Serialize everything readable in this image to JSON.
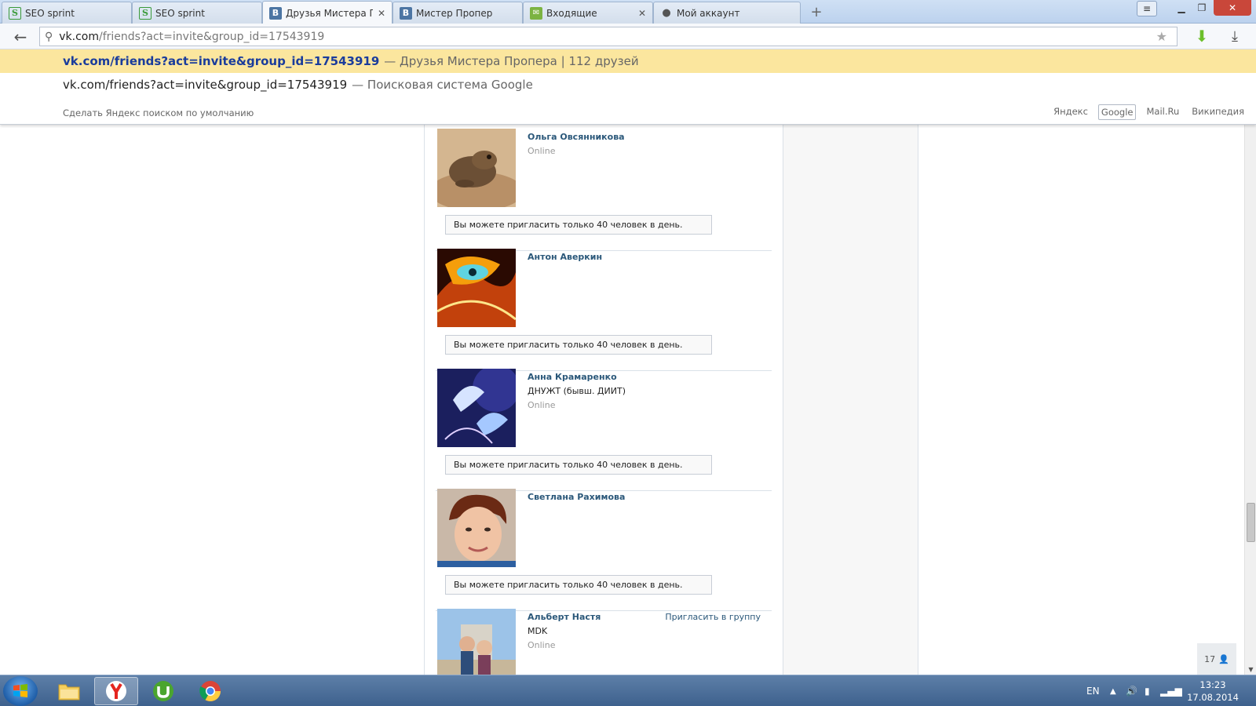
{
  "tabs": [
    {
      "label": "SEO sprint",
      "icon": "seo-sprint-icon",
      "active": false
    },
    {
      "label": "SEO sprint",
      "icon": "seo-sprint-icon",
      "active": false
    },
    {
      "label": "Друзья Мистера Про",
      "icon": "vk-icon",
      "active": true
    },
    {
      "label": "Мистер Пропер",
      "icon": "vk-icon",
      "active": false
    },
    {
      "label": "Входящие",
      "icon": "mail-icon",
      "active": false
    },
    {
      "label": "Мой аккаунт",
      "icon": "account-icon",
      "active": false
    }
  ],
  "address": {
    "host": "vk.com",
    "path": "/friends?act=invite&group_id=17543919"
  },
  "suggestions": [
    {
      "url": "vk.com/friends?act=invite&group_id=17543919",
      "desc": "— Друзья Мистера Пропера | 112 друзей"
    },
    {
      "url": "vk.com/friends?act=invite&group_id=17543919",
      "desc": "— Поисковая система Google"
    }
  ],
  "suggestion_footer": "Сделать Яндекс поиском по умолчанию",
  "search_engines": [
    "Яндекс",
    "Google",
    "Mail.Ru",
    "Википедия"
  ],
  "selected_engine": "Google",
  "friends": [
    {
      "name": "Ольга Овсянникова",
      "info": "",
      "status": "Online",
      "notice": "Вы можете пригласить только 40 человек в день.",
      "avatar": "toad-photo"
    },
    {
      "name": "Антон Аверкин",
      "info": "",
      "status": "",
      "notice": "Вы можете пригласить только 40 человек в день.",
      "avatar": "fire-eye-photo"
    },
    {
      "name": "Анна Крамаренко",
      "info": "ДНУЖТ (бывш. ДИИТ)",
      "status": "Online",
      "notice": "Вы можете пригласить только 40 человек в день.",
      "avatar": "birds-photo"
    },
    {
      "name": "Светлана Рахимова",
      "info": "",
      "status": "",
      "notice": "Вы можете пригласить только 40 человек в день.",
      "avatar": "woman-photo"
    },
    {
      "name": "Альберт Настя",
      "info": "MDK",
      "status": "Online",
      "invite_label": "Пригласить в группу",
      "avatar": "couple-photo"
    }
  ],
  "counter": "17",
  "taskbar": {
    "language": "EN",
    "time": "13:23",
    "date": "17.08.2014"
  },
  "colors": {
    "vk_link": "#2b587a",
    "suggestion_highlight": "#fbe69e",
    "taskbar": "#4a6d98"
  }
}
